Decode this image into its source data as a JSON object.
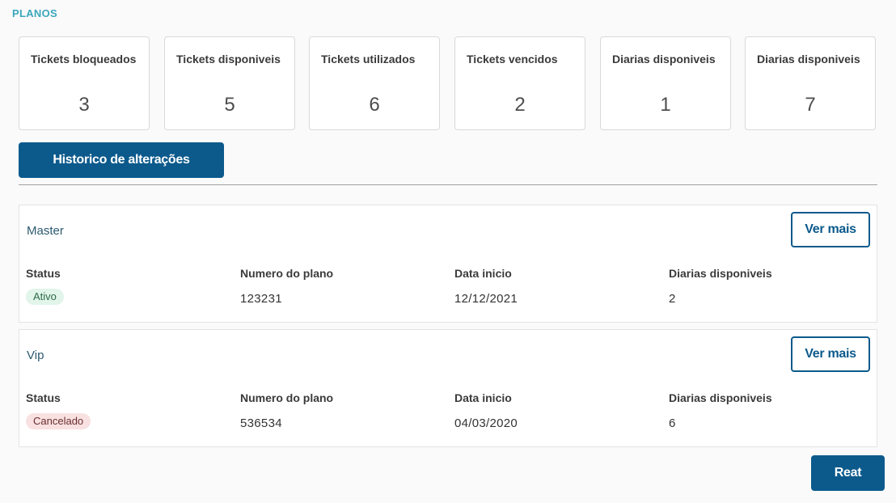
{
  "section_title": "PLANOS",
  "stats": [
    {
      "label": "Tickets bloqueados",
      "value": "3"
    },
    {
      "label": "Tickets disponiveis",
      "value": "5"
    },
    {
      "label": "Tickets utilizados",
      "value": "6"
    },
    {
      "label": "Tickets vencidos",
      "value": "2"
    },
    {
      "label": "Diarias disponiveis",
      "value": "1"
    },
    {
      "label": "Diarias disponiveis",
      "value": "7"
    }
  ],
  "history_button": "Historico de alterações",
  "field_labels": {
    "status": "Status",
    "plan_number": "Numero do plano",
    "start_date": "Data inicio",
    "available_days": "Diarias disponiveis"
  },
  "plans": [
    {
      "name": "Master",
      "more_label": "Ver mais",
      "status": "Ativo",
      "status_color": "#e1f5ea",
      "plan_number": "123231",
      "start_date": "12/12/2021",
      "available_days": "2"
    },
    {
      "name": "Vip",
      "more_label": "Ver mais",
      "status": "Cancelado",
      "status_color": "#f9e1e1",
      "plan_number": "536534",
      "start_date": "04/03/2020",
      "available_days": "6"
    }
  ],
  "reat_button": "Reat",
  "colors": {
    "primary": "#0c5a8c",
    "section_title": "#3aa6bd"
  }
}
